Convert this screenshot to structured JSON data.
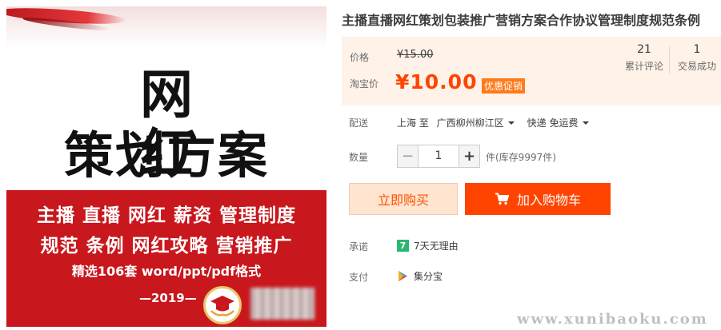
{
  "image": {
    "headline_top": "网 红",
    "headline_bottom": "策划方案",
    "line1": "主播 直播 网红 薪资 管理制度",
    "line2": "规范 条例 网红攻略 营销推广",
    "line3": "精选106套 word/ppt/pdf格式",
    "year": "—2019—"
  },
  "product": {
    "title": "主播直播网红策划包装推广营销方案合作协议管理制度规范条例"
  },
  "price": {
    "label": "价格",
    "original": "¥15.00",
    "taobao_label": "淘宝价",
    "current": "¥10.00",
    "promo": "优惠促销"
  },
  "stats": {
    "reviews_count": "21",
    "reviews_label": "累计评论",
    "deals_count": "1",
    "deals_label": "交易成功"
  },
  "shipping": {
    "label": "配送",
    "from": "上海 至",
    "to": "广西柳州柳江区",
    "method": "快递 免运费"
  },
  "quantity": {
    "label": "数量",
    "minus": "−",
    "value": "1",
    "plus": "+",
    "stock": "件(库存9997件)"
  },
  "actions": {
    "buy_now": "立即购买",
    "add_to_cart": "加入购物车"
  },
  "services": {
    "promise_label": "承诺",
    "promise_badge": "7",
    "promise_text": "7天无理由",
    "pay_label": "支付",
    "pay_text": "集分宝"
  },
  "watermark": "www.xunibaoku.com",
  "colors": {
    "accent": "#ff4400",
    "price_bg": "#fff2e8",
    "banner_red": "#c8171d"
  }
}
